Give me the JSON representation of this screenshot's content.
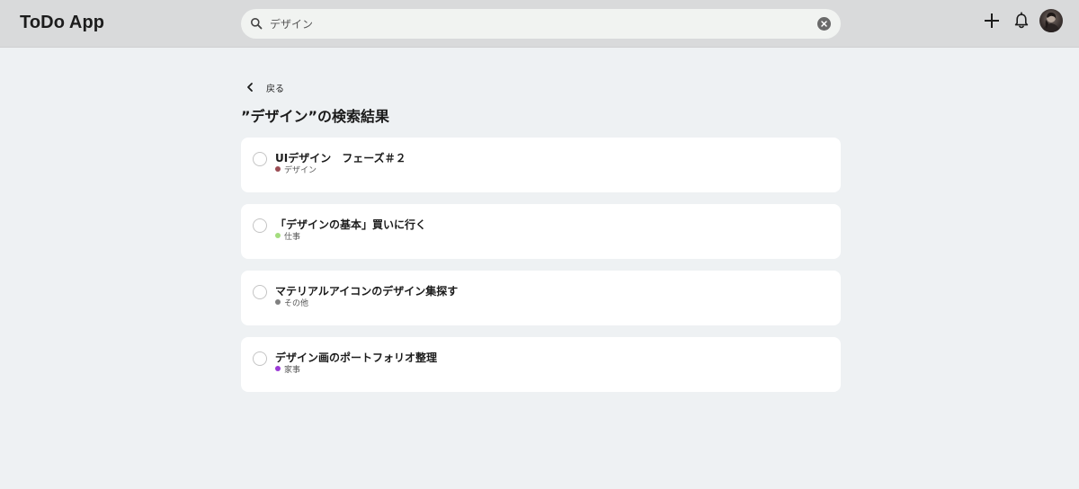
{
  "header": {
    "app_title": "ToDo App",
    "search": {
      "value": "デザイン"
    },
    "icons": [
      "search-icon",
      "clear-icon",
      "plus-icon",
      "bell-icon",
      "avatar"
    ]
  },
  "main": {
    "back_label": "戻る",
    "title": "”デザイン”の検索結果",
    "tasks": [
      {
        "title": "UIデザイン　フェーズ＃２",
        "tag": "デザイン",
        "tag_color": "#9b4d54"
      },
      {
        "title": "「デザインの基本」買いに行く",
        "tag": "仕事",
        "tag_color": "#a4dd7f"
      },
      {
        "title": "マテリアルアイコンのデザイン集探す",
        "tag": "その他",
        "tag_color": "#808080"
      },
      {
        "title": "デザイン画のポートフォリオ整理",
        "tag": "家事",
        "tag_color": "#9b3ad6"
      }
    ]
  },
  "colors": {
    "header_bg": "#d9dadb",
    "page_bg": "#eef1f3",
    "card_bg": "#ffffff"
  }
}
